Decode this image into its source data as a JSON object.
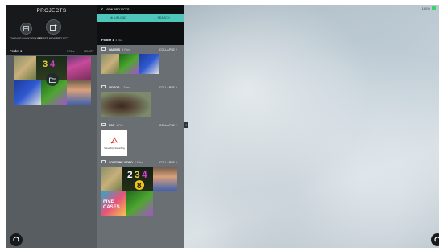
{
  "projects": {
    "title": "PROJECTS",
    "change_background_label": "CHANGE BACKGROUND",
    "create_project_label": "CREATE NEW PROJECT",
    "folder_name": "Folder 1",
    "folder_meta": "3 Files",
    "folder_select": "SELECT"
  },
  "media": {
    "back_label": "VIEW PROJECTS",
    "tab_upload": "UPLOAD",
    "tab_search": "SEARCH",
    "folder_name": "Folder 1",
    "folder_meta": "4 Files",
    "sections": [
      {
        "name": "IMAGES",
        "count": "3 Files",
        "collapse": "COLLAPSE"
      },
      {
        "name": "VIDEOS",
        "count": "1 Files",
        "collapse": "COLLAPSE"
      },
      {
        "name": "PDF",
        "count": "1 File",
        "collapse": "COLLAPSE"
      },
      {
        "name": "YOUTUBE VIDEO",
        "count": "3 Files",
        "collapse": "COLLAPSE"
      }
    ],
    "pdf_caption": "Something Something"
  },
  "canvas": {
    "zoom": "100%"
  },
  "colors": {
    "accent": "#4fc6bc",
    "panel_dark": "#17191b",
    "zoom_dot": "#3bd16f"
  }
}
